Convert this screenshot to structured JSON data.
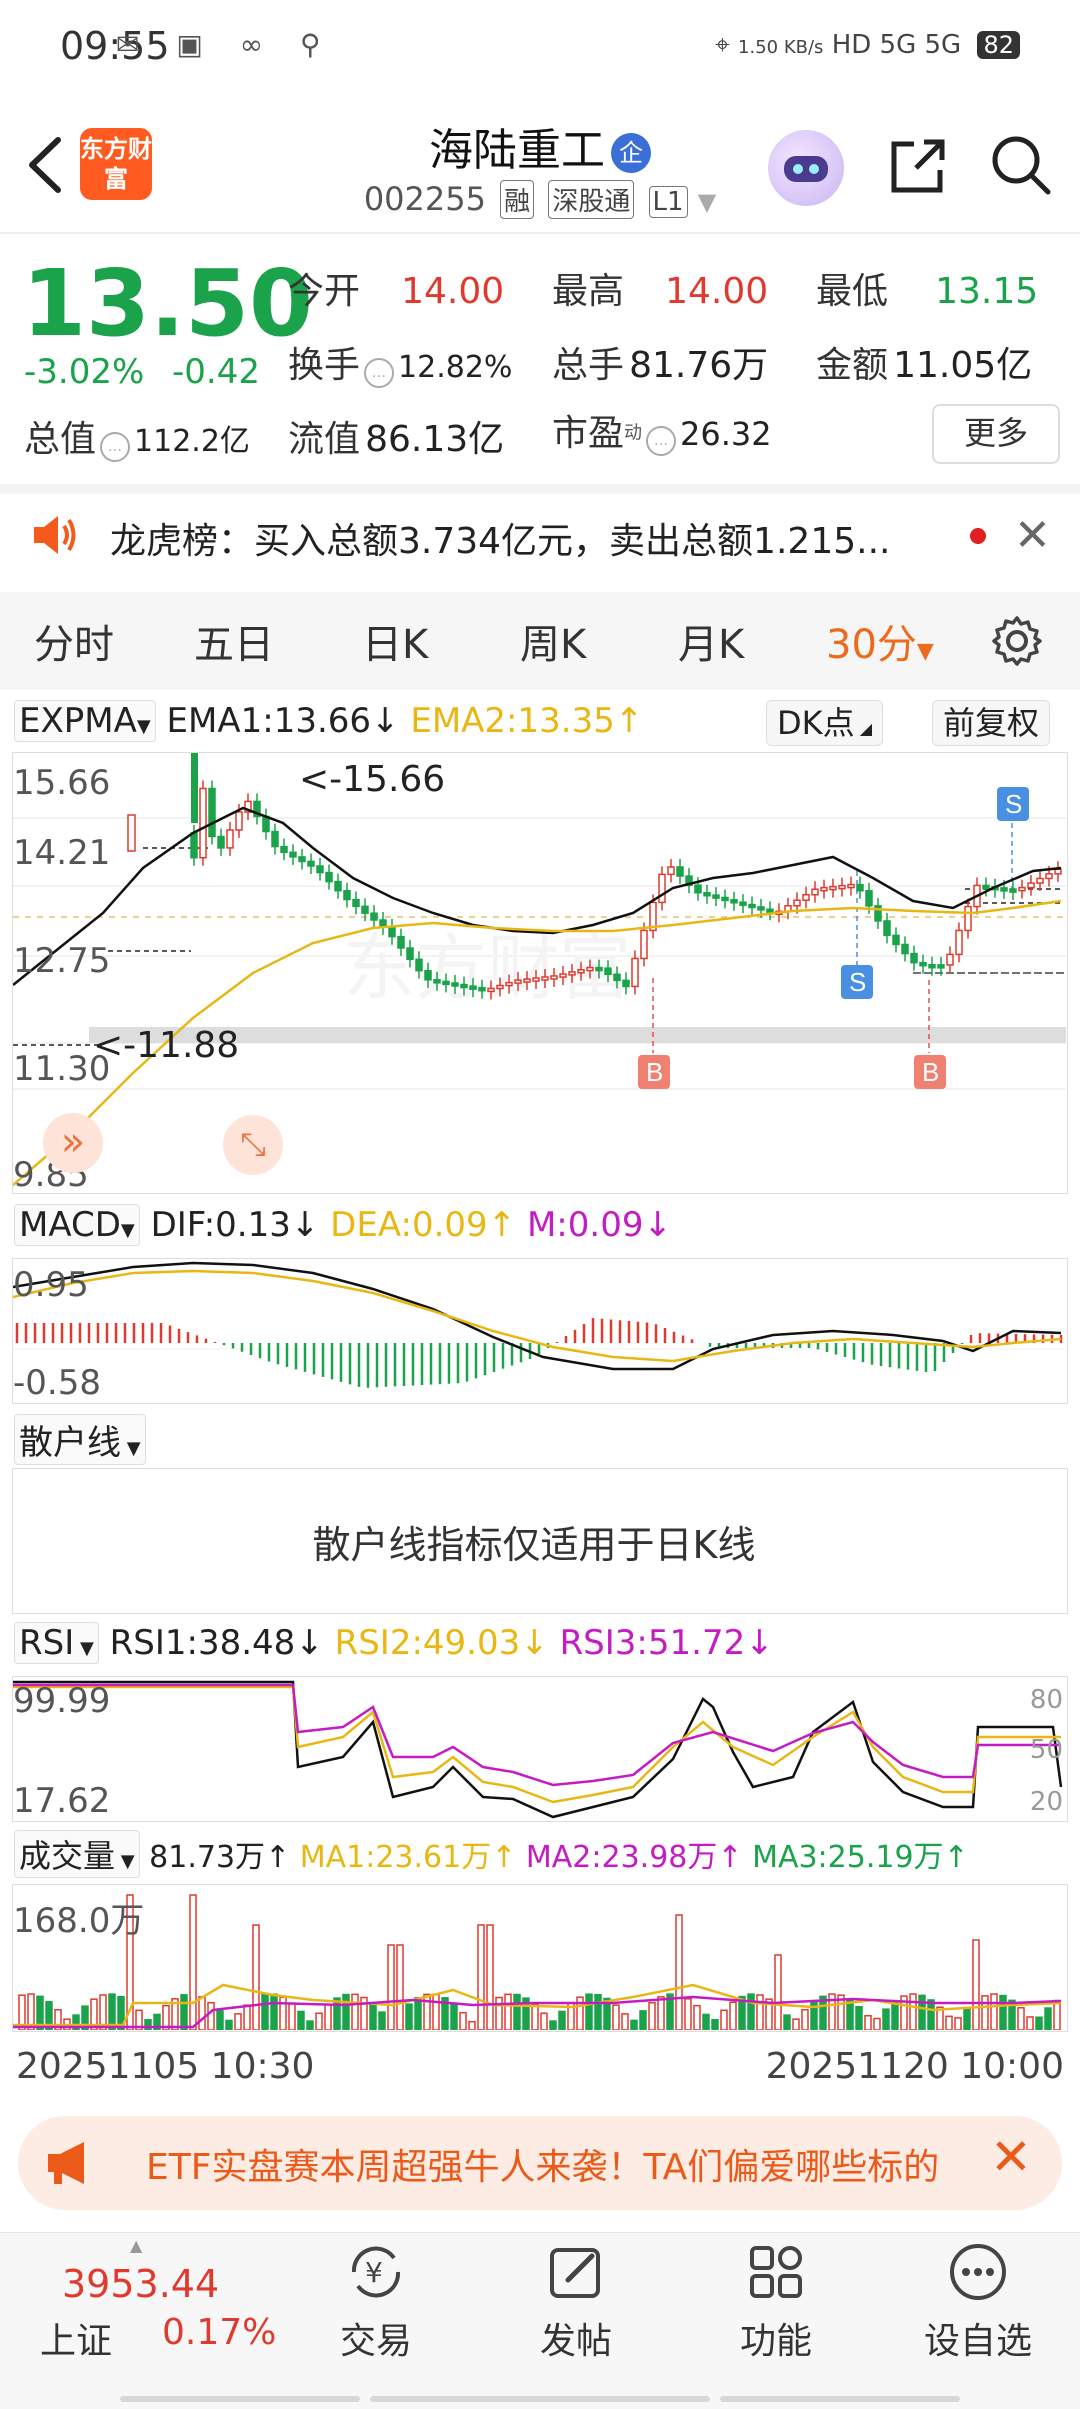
{
  "status_bar": {
    "time": "09:55",
    "net_speed": "1.50 KB/s",
    "network": "HD 5G 5G",
    "battery": "82"
  },
  "header": {
    "logo_text": "东方财富",
    "stock_name": "海陆重工",
    "badge": "企",
    "stock_code": "002255",
    "tag_rong": "融",
    "tag_sgt": "深股通",
    "tag_l1": "L1"
  },
  "quote": {
    "price": "13.50",
    "change_pct": "-3.02%",
    "change_amt": "-0.42",
    "open_label": "今开",
    "open": "14.00",
    "high_label": "最高",
    "high": "14.00",
    "low_label": "最低",
    "low": "13.15",
    "turnover_label": "换手",
    "turnover": "12.82%",
    "volume_label": "总手",
    "volume": "81.76万",
    "amount_label": "金额",
    "amount": "11.05亿",
    "mktcap_label": "总值",
    "mktcap": "112.2亿",
    "float_label": "流值",
    "float_cap": "86.13亿",
    "pe_label": "市盈",
    "pe_sup": "动",
    "pe": "26.32",
    "more_button": "更多"
  },
  "notice": {
    "text": "龙虎榜：买入总额3.734亿元，卖出总额1.215..."
  },
  "tabs": [
    "分时",
    "五日",
    "日K",
    "周K",
    "月K",
    "30分"
  ],
  "active_tab_index": 5,
  "kline": {
    "indicator": "EXPMA",
    "ema1": "EMA1:13.66↓",
    "ema2": "EMA2:13.35↑",
    "dk_button": "DK点",
    "fq_button": "前复权",
    "y_labels": [
      "15.66",
      "14.21",
      "12.75",
      "11.30",
      "9.85"
    ],
    "max_annot": "<-15.66",
    "min_annot": "<-11.88",
    "b_marker": "B",
    "s_marker": "S",
    "watermark": "东方财富"
  },
  "macd": {
    "indicator": "MACD",
    "dif": "DIF:0.13↓",
    "dea": "DEA:0.09↑",
    "m": "M:0.09↓",
    "y_top": "0.95",
    "y_bottom": "-0.58"
  },
  "retail": {
    "indicator": "散户线",
    "message": "散户线指标仅适用于日K线"
  },
  "rsi": {
    "indicator": "RSI",
    "rsi1": "RSI1:38.48↓",
    "rsi2": "RSI2:49.03↓",
    "rsi3": "RSI3:51.72↓",
    "y_top": "99.99",
    "y_bottom": "17.62",
    "r_labels": [
      "80",
      "50",
      "20"
    ]
  },
  "volume": {
    "indicator": "成交量",
    "vol": "81.73万↑",
    "ma1": "MA1:23.61万↑",
    "ma2": "MA2:23.98万↑",
    "ma3": "MA3:25.19万↑",
    "y_top": "168.0万"
  },
  "dates": {
    "start": "20251105 10:30",
    "end": "20251120 10:00"
  },
  "banner": {
    "text": "ETF实盘赛本周超强牛人来袭！TA们偏爱哪些标的"
  },
  "bottom_nav": {
    "index_value": "3953.44",
    "index_name": "上证",
    "index_pct": "0.17%",
    "items": [
      "交易",
      "发帖",
      "功能",
      "设自选"
    ]
  },
  "colors": {
    "up": "#e03a2f",
    "down": "#1aa34a",
    "ema2": "#e8b714",
    "accent": "#ec6b1c",
    "magenta": "#c41cc4"
  }
}
